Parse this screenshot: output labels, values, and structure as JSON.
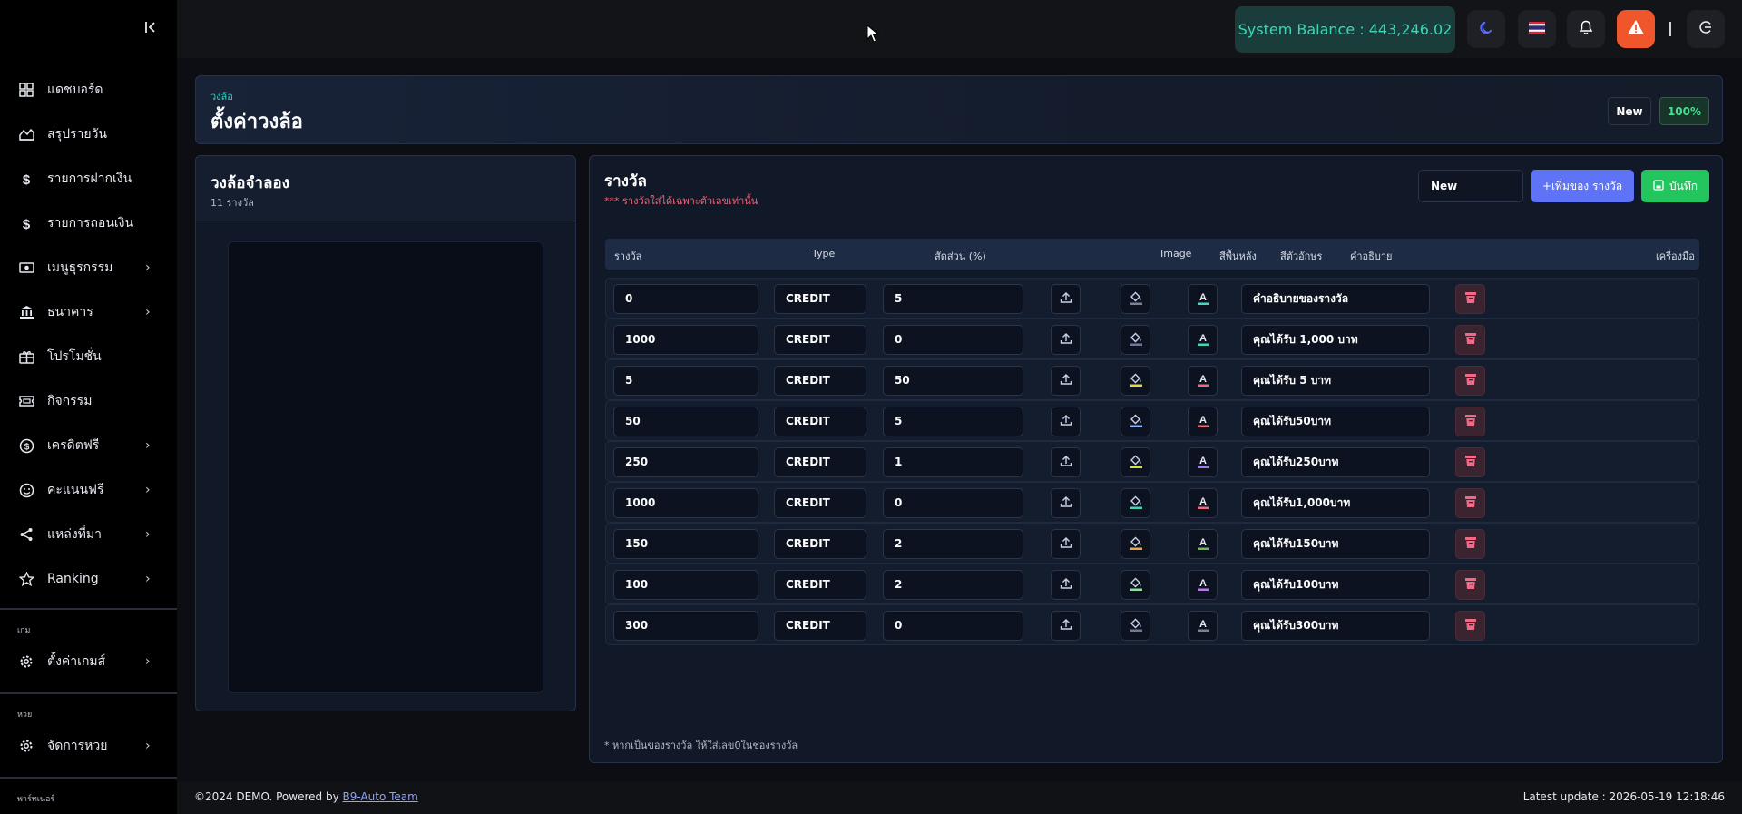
{
  "sidebar": {
    "items": [
      {
        "label": "แดชบอร์ด",
        "icon": "dashboard-icon"
      },
      {
        "label": "สรุปรายวัน",
        "icon": "chart-area-icon"
      },
      {
        "label": "รายการฝากเงิน",
        "icon": "dollar-icon"
      },
      {
        "label": "รายการถอนเงิน",
        "icon": "dollar-icon"
      },
      {
        "label": "เมนูธุรกรรม",
        "icon": "money-bill-icon"
      },
      {
        "label": "ธนาคาร",
        "icon": "bank-icon"
      },
      {
        "label": "โปรโมชั่น",
        "icon": "gift-icon"
      },
      {
        "label": "กิจกรรม",
        "icon": "ticket-icon"
      },
      {
        "label": "เครดิตฟรี",
        "icon": "coin-icon"
      },
      {
        "label": "คะแนนฟรี",
        "icon": "smile-icon"
      },
      {
        "label": "แหล่งที่มา",
        "icon": "share-icon"
      },
      {
        "label": "Ranking",
        "icon": "star-icon"
      }
    ],
    "section_game": "เกม",
    "game_item": "ตั้งค่าเกมส์",
    "section_lotto": "หวย",
    "lotto_item": "จัดการหวย",
    "section_partner": "พาร์ทเนอร์"
  },
  "topbar": {
    "balance": "System Balance : 443,246.02",
    "icons": [
      "moon-icon",
      "thai-flag-icon",
      "bell-icon",
      "warning-icon",
      "logout-icon"
    ]
  },
  "header": {
    "breadcrumb": "วงล้อ",
    "title": "ตั้งค่าวงล้อ",
    "badge_new": "New",
    "badge_percent": "100%"
  },
  "left_panel": {
    "title": "วงล้อจำลอง",
    "subtitle": "11 รางวัล"
  },
  "right_panel": {
    "title": "รางวัล",
    "note": "*** รางวัลใส่ได้เฉพาะตัวเลขเท่านั้น",
    "select_value": "New",
    "add_label": "+เพิ่มของ รางวัล",
    "save_label": "บันทึก",
    "columns": [
      "รางวัล",
      "Type",
      "สัดส่วน (%)",
      "Image",
      "สีพื้นหลัง",
      "สีตัวอักษร",
      "คำอธิบาย",
      "เครื่องมือ"
    ],
    "rows": [
      {
        "reward": "0",
        "type": "CREDIT",
        "ratio": "5",
        "desc": "คำอธิบายของรางวัล",
        "bg": "#7a8194",
        "fg": "#4ad5c3"
      },
      {
        "reward": "1000",
        "type": "CREDIT",
        "ratio": "0",
        "desc": "คุณได้รับ 1,000 บาท",
        "bg": "#6e7a96",
        "fg": "#3ed6b7"
      },
      {
        "reward": "5",
        "type": "CREDIT",
        "ratio": "50",
        "desc": "คุณได้รับ 5 บาท",
        "bg": "#e3d84c",
        "fg": "#ef6b7b"
      },
      {
        "reward": "50",
        "type": "CREDIT",
        "ratio": "5",
        "desc": "คุณได้รับ50บาท",
        "bg": "#8fb3ff",
        "fg": "#ef6b7b"
      },
      {
        "reward": "250",
        "type": "CREDIT",
        "ratio": "1",
        "desc": "คุณได้รับ250บาท",
        "bg": "#d8e04c",
        "fg": "#a37bf0"
      },
      {
        "reward": "1000",
        "type": "CREDIT",
        "ratio": "0",
        "desc": "คุณได้รับ1,000บาท",
        "bg": "#3ed6b7",
        "fg": "#ef6b7b"
      },
      {
        "reward": "150",
        "type": "CREDIT",
        "ratio": "2",
        "desc": "คุณได้รับ150บาท",
        "bg": "#e9a84a",
        "fg": "#6abf5a"
      },
      {
        "reward": "100",
        "type": "CREDIT",
        "ratio": "2",
        "desc": "คุณได้รับ100บาท",
        "bg": "#8ee0a0",
        "fg": "#b87be8"
      },
      {
        "reward": "300",
        "type": "CREDIT",
        "ratio": "0",
        "desc": "คุณได้รับ300บาท",
        "bg": "#6e7a96",
        "fg": "#7a8194"
      }
    ],
    "foot_note": "* หากเป็นของรางวัล ให้ใส่เลข0ในช่องรางวัล"
  },
  "footer": {
    "left_prefix": "©2024 DEMO. Powered by ",
    "link": "B9-Auto ",
    "left_suffix": "Team",
    "right": "Latest update : 2026-05-19 12:18:46"
  }
}
